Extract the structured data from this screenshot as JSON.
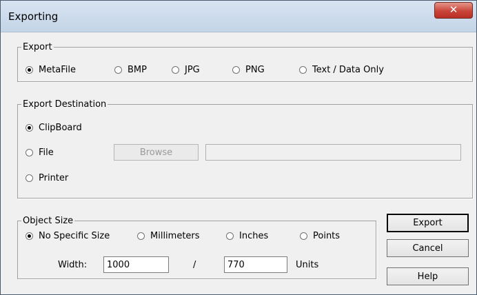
{
  "window": {
    "title": "Exporting",
    "close_glyph": "✕"
  },
  "export": {
    "legend": "Export",
    "options": [
      {
        "label": "MetaFile",
        "checked": true
      },
      {
        "label": "BMP",
        "checked": false
      },
      {
        "label": "JPG",
        "checked": false
      },
      {
        "label": "PNG",
        "checked": false
      },
      {
        "label": "Text / Data Only",
        "checked": false
      }
    ]
  },
  "destination": {
    "legend": "Export Destination",
    "options": [
      {
        "label": "ClipBoard",
        "checked": true
      },
      {
        "label": "File",
        "checked": false
      },
      {
        "label": "Printer",
        "checked": false
      }
    ],
    "browse_label": "Browse",
    "file_path": ""
  },
  "object_size": {
    "legend": "Object Size",
    "options": [
      {
        "label": "No Specific Size",
        "checked": true
      },
      {
        "label": "Millimeters",
        "checked": false
      },
      {
        "label": "Inches",
        "checked": false
      },
      {
        "label": "Points",
        "checked": false
      }
    ],
    "width_label": "Width:",
    "width_value": "1000",
    "separator": "/",
    "height_value": "770",
    "units_label": "Units"
  },
  "buttons": {
    "export": "Export",
    "cancel": "Cancel",
    "help": "Help"
  }
}
